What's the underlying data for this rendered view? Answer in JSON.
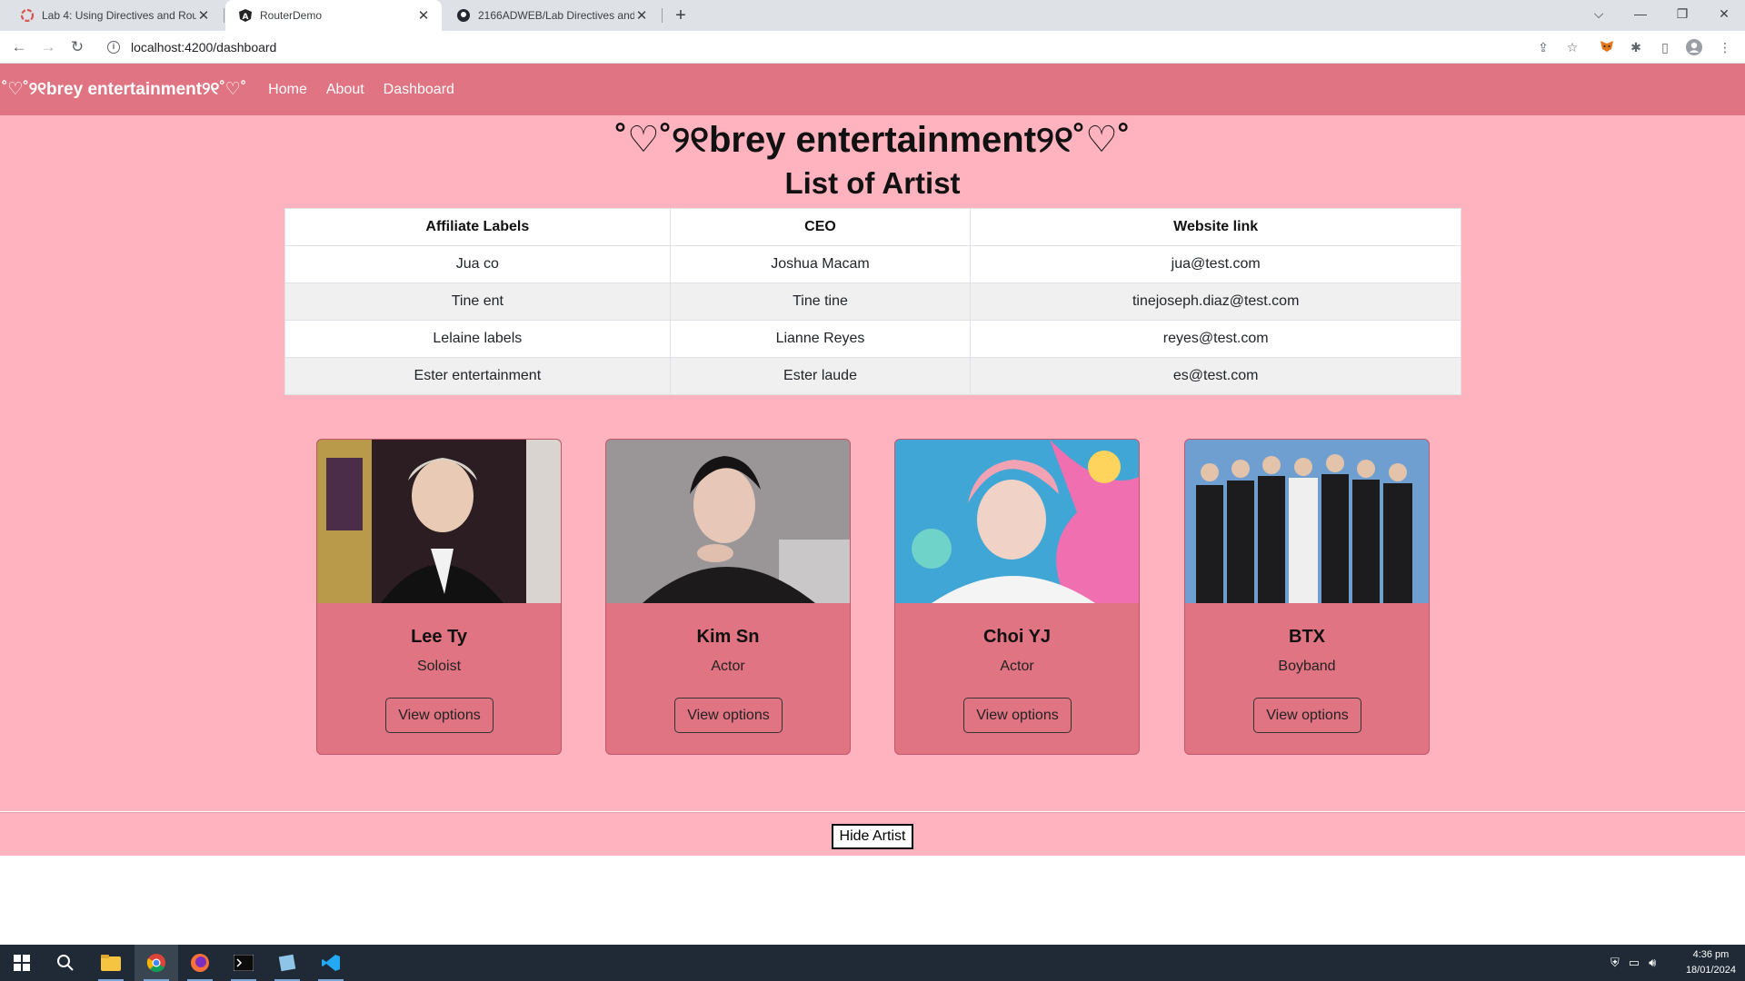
{
  "browser": {
    "tabs": [
      {
        "title": "Lab 4: Using Directives and Routi",
        "active": false
      },
      {
        "title": "RouterDemo",
        "active": true
      },
      {
        "title": "2166ADWEB/Lab Directives and",
        "active": false
      }
    ],
    "url": "localhost:4200/dashboard"
  },
  "nav": {
    "brand": "˚♡˚୨୧brey entertainment୨୧˚♡˚",
    "links": [
      "Home",
      "About",
      "Dashboard"
    ]
  },
  "main": {
    "title": "˚♡˚୨୧brey entertainment୨୧˚♡˚",
    "subtitle": "List of Artist"
  },
  "table": {
    "headers": [
      "Affiliate Labels",
      "CEO",
      "Website link"
    ],
    "rows": [
      [
        "Jua co",
        "Joshua Macam",
        "jua@test.com"
      ],
      [
        "Tine ent",
        "Tine tine",
        "tinejoseph.diaz@test.com"
      ],
      [
        "Lelaine labels",
        "Lianne Reyes",
        "reyes@test.com"
      ],
      [
        "Ester entertainment",
        "Ester laude",
        "es@test.com"
      ]
    ]
  },
  "artists": [
    {
      "name": "Lee Ty",
      "role": "Soloist",
      "button": "View options"
    },
    {
      "name": "Kim Sn",
      "role": "Actor",
      "button": "View options"
    },
    {
      "name": "Choi YJ",
      "role": "Actor",
      "button": "View options"
    },
    {
      "name": "BTX",
      "role": "Boyband",
      "button": "View options"
    }
  ],
  "footer": {
    "hide_button": "Hide Artist"
  },
  "taskbar": {
    "time": "4:36 pm",
    "date": "18/01/2024"
  },
  "colors": {
    "nav": "#e07482",
    "page_bg": "#ffb3bf",
    "card": "#e07482"
  }
}
